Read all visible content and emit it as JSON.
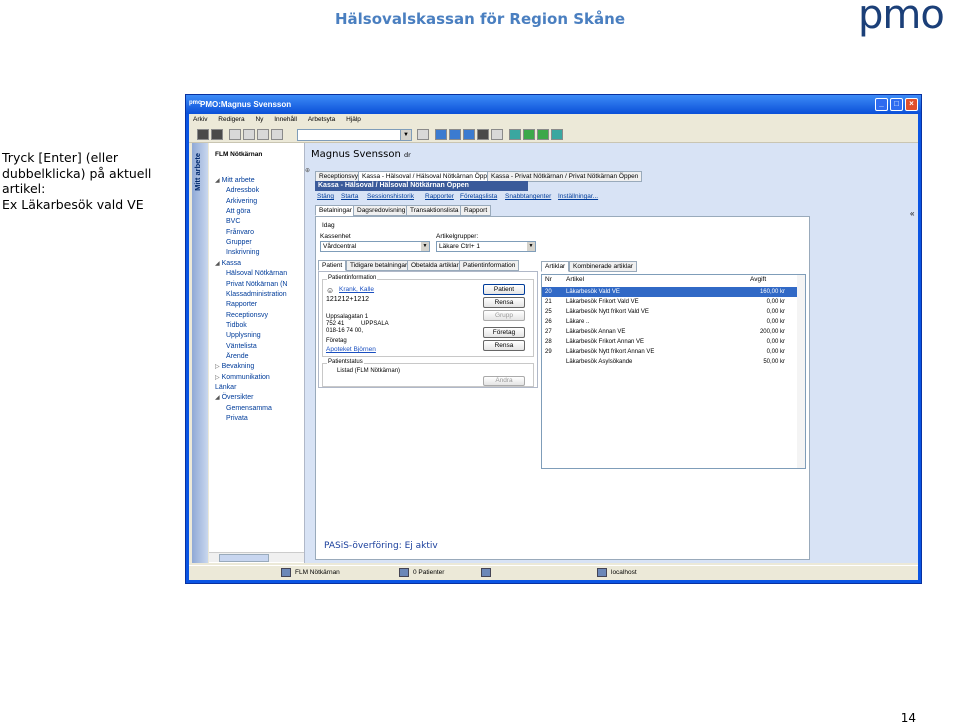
{
  "slide": {
    "title": "Hälsovalskassan för Region Skåne",
    "logo": "pmo",
    "instruction": [
      "Tryck [Enter] (eller",
      "dubbelklicka) på aktuell",
      "artikel:",
      "Ex Läkarbesök vald VE"
    ],
    "page_number": "14"
  },
  "window": {
    "app_icon": "pmo",
    "title": "PMO:Magnus Svensson",
    "controls": {
      "minimize": "_",
      "maximize": "□",
      "close": "×"
    }
  },
  "menu": [
    "Arkiv",
    "Redigera",
    "Ny",
    "Innehåll",
    "Arbetsyta",
    "Hjälp"
  ],
  "sidebar": {
    "tab_label": "Mitt arbete",
    "header": "FLM Nötkärnan",
    "tree": [
      {
        "label": "Mitt arbete",
        "arrow": "◢"
      },
      {
        "label": "Adressbok"
      },
      {
        "label": "Arkivering"
      },
      {
        "label": "Att göra"
      },
      {
        "label": "BVC"
      },
      {
        "label": "Frånvaro"
      },
      {
        "label": "Grupper"
      },
      {
        "label": "Inskrivning"
      },
      {
        "label": "Kassa",
        "arrow": "◢"
      },
      {
        "label": "Hälsoval Nötkärnan"
      },
      {
        "label": "Privat Nötkärnan (N"
      },
      {
        "label": "Klassadministration"
      },
      {
        "label": "Rapporter"
      },
      {
        "label": "Receptionsvy"
      },
      {
        "label": "Tidbok"
      },
      {
        "label": "Upplysning"
      },
      {
        "label": "Väntelista"
      },
      {
        "label": "Ärende"
      },
      {
        "label": "Bevakning",
        "arrow": "▷"
      },
      {
        "label": "Kommunikation",
        "arrow": "▷"
      },
      {
        "label": "Länkar"
      },
      {
        "label": "Översikter",
        "arrow": "◢"
      },
      {
        "label": "Gemensamma"
      },
      {
        "label": "Privata"
      }
    ]
  },
  "main": {
    "person_name": "Magnus Svensson",
    "person_suffix": "dr",
    "top_tabs": [
      "Receptionsvy",
      "Kassa - Hälsoval / Hälsoval Nötkärnan Öppen",
      "Kassa - Privat Nötkärnan / Privat Nötkärnan Öppen"
    ],
    "kassa_header": "Kassa - Hälsoval / Hälsoval Nötkärnan Öppen",
    "subnav": [
      "Stäng",
      "Starta",
      "Sessionshistorik",
      "Rapporter",
      "Företagslista",
      "Snabbtangenter",
      "Inställningar..."
    ],
    "inner_tabs": [
      "Betalningar",
      "Dagsredovisning",
      "Transaktionslista",
      "Rapport"
    ],
    "period_label": "Idag",
    "kassaenhet_label": "Kassenhet",
    "kassaenhet_value": "Vårdcentral",
    "artikelgrupper_label": "Artikelgrupper:",
    "artikelgrupper_value": "Läkare Ctrl+ 1",
    "patient_tabs": [
      "Patient",
      "Tidigare betalningar",
      "Obetalda artiklar",
      "Patientinformation"
    ],
    "patientinfo": {
      "title": "Patientinformation",
      "name": "Krank, Kalle",
      "pnr": "121212+1212",
      "address1": "Uppsalagatan 1",
      "zip": "752 41",
      "city": "UPPSALA",
      "phone": "018-16 74 00,",
      "company_label": "Företag",
      "company": "Apoteket Björnen"
    },
    "patient_buttons": [
      "Patient",
      "Rensa",
      "Grupp",
      "Företag",
      "Rensa"
    ],
    "patientstatus": {
      "title": "Patientstatus",
      "value": "Listad (FLM Nötkärnan)",
      "button": "Ändra"
    },
    "pasis": "PASiS-överföring: Ej aktiv",
    "article_tabs": [
      "Artiklar",
      "Kombinerade artiklar"
    ],
    "article_headers": [
      "Nr",
      "Artikel",
      "Avgift"
    ],
    "articles": [
      {
        "nr": "20",
        "name": "Läkarbesök Vald VE",
        "fee": "160,00 kr",
        "selected": true
      },
      {
        "nr": "21",
        "name": "Läkarbesök Frikort Vald VE",
        "fee": "0,00 kr"
      },
      {
        "nr": "25",
        "name": "Läkarbesök Nytt frikort Vald VE",
        "fee": "0,00 kr"
      },
      {
        "nr": "26",
        "name": "Läkare ..",
        "fee": "0,00 kr"
      },
      {
        "nr": "27",
        "name": "Läkarbesök Annan VE",
        "fee": "200,00 kr"
      },
      {
        "nr": "28",
        "name": "Läkarbesök Frikort Annan VE",
        "fee": "0,00 kr"
      },
      {
        "nr": "29",
        "name": "Läkarbesök Nytt frikort Annan VE",
        "fee": "0,00 kr"
      },
      {
        "nr": "",
        "name": "Läkarbesök Asylsökande",
        "fee": "50,00 kr"
      }
    ]
  },
  "statusbar": {
    "unit": "FLM Nötkärnan",
    "patients": "0 Patienter",
    "host": "localhost"
  }
}
